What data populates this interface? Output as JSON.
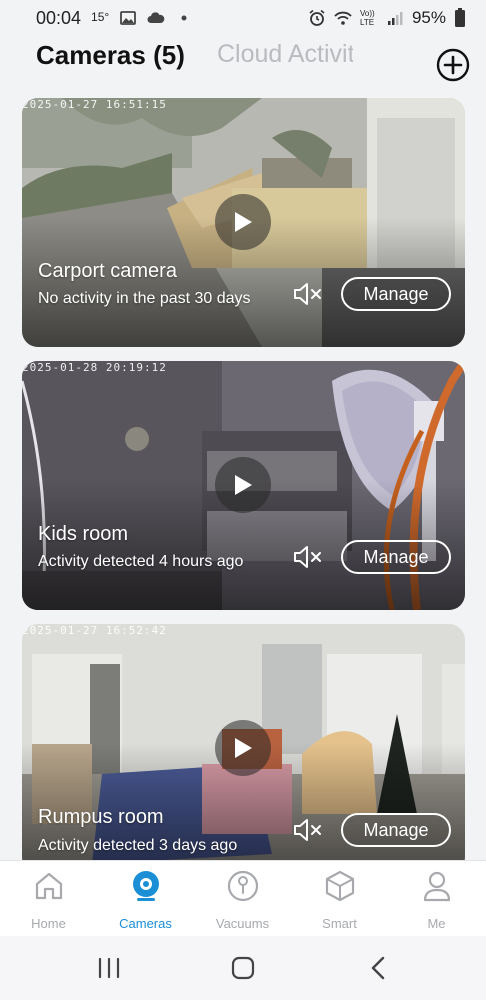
{
  "status_bar": {
    "time": "00:04",
    "temperature": "15°",
    "battery": "95%",
    "volte": "Vo)) LTE"
  },
  "header": {
    "active_tab": "Cameras (5)",
    "inactive_tab": "Cloud Activit",
    "add_icon": "plus-circle-icon"
  },
  "cameras": [
    {
      "timestamp": "2025-01-27 16:51:15",
      "name": "Carport camera",
      "status": "No activity in the past 30 days",
      "manage_label": "Manage"
    },
    {
      "timestamp": "2025-01-28 20:19:12",
      "name": "Kids room",
      "status": "Activity detected 4 hours ago",
      "manage_label": "Manage"
    },
    {
      "timestamp": "2025-01-27 16:52:42",
      "name": "Rumpus room",
      "status": "Activity detected 3 days ago",
      "manage_label": "Manage"
    }
  ],
  "bottom_nav": [
    {
      "label": "Home",
      "icon": "home-icon",
      "active": false
    },
    {
      "label": "Cameras",
      "icon": "camera-icon",
      "active": true
    },
    {
      "label": "Vacuums",
      "icon": "vacuum-icon",
      "active": false
    },
    {
      "label": "Smart",
      "icon": "cube-icon",
      "active": false
    },
    {
      "label": "Me",
      "icon": "person-icon",
      "active": false
    }
  ],
  "colors": {
    "accent": "#1a8fd6",
    "inactive": "#a7a9ad",
    "background": "#f2f3f5"
  }
}
